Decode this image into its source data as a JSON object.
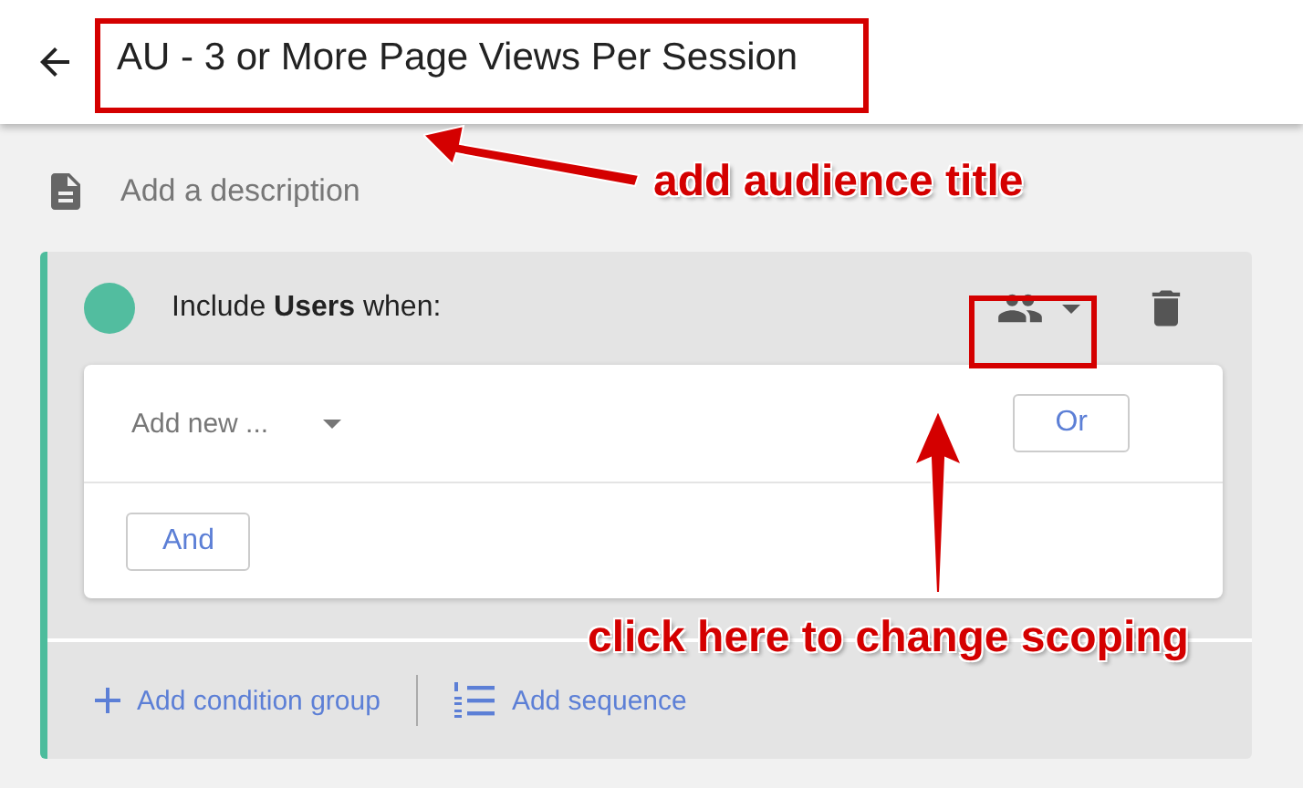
{
  "header": {
    "title": "AU - 3 or More Page Views Per Session"
  },
  "description": {
    "placeholder": "Add a description"
  },
  "condition_group": {
    "color": "#52bd9f",
    "label": "Include **Users** when:",
    "condition_placeholder": "Add new ...",
    "or_button": "Or",
    "and_button": "And"
  },
  "footer_links": [
    "Add condition group",
    "Add sequence"
  ],
  "annotations": [
    "add audience title",
    "click here to change scoping"
  ]
}
